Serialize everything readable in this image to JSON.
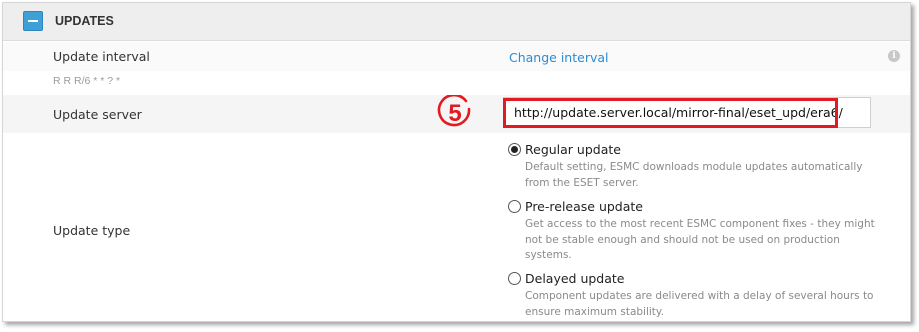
{
  "header": {
    "title": "UPDATES"
  },
  "interval": {
    "label": "Update interval",
    "link": "Change interval",
    "cron": "R R R/6 * * ? *"
  },
  "server": {
    "label": "Update server",
    "value": "http://update.server.local/mirror-final/eset_upd/era6/",
    "callout_number": "5",
    "callout_color": "#e11b22"
  },
  "update_type": {
    "label": "Update type",
    "options": [
      {
        "label": "Regular update",
        "desc": "Default setting, ESMC downloads module updates automatically from the ESET server.",
        "selected": true
      },
      {
        "label": "Pre-release update",
        "desc": "Get access to the most recent ESMC component fixes - they might not be stable enough and should not be used on production systems.",
        "selected": false
      },
      {
        "label": "Delayed update",
        "desc": "Component updates are delivered with a delay of several hours to ensure maximum stability.",
        "selected": false
      }
    ]
  },
  "colors": {
    "accent": "#3fa0d8",
    "link": "#2a8bd6",
    "highlight": "#e11b22"
  }
}
